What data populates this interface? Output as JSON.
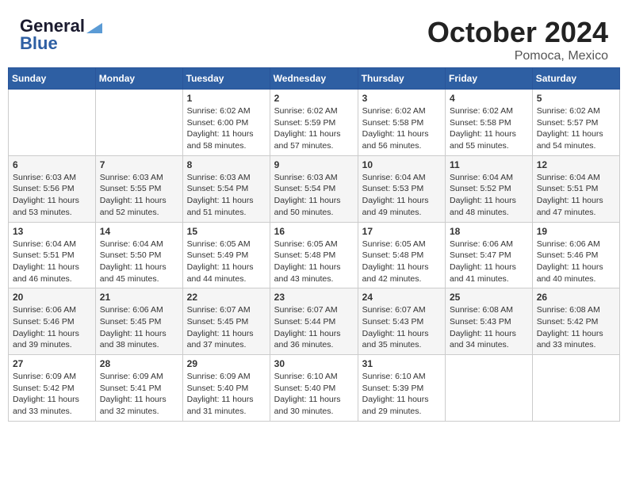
{
  "header": {
    "logo_line1": "General",
    "logo_line2": "Blue",
    "title": "October 2024",
    "subtitle": "Pomoca, Mexico"
  },
  "weekdays": [
    "Sunday",
    "Monday",
    "Tuesday",
    "Wednesday",
    "Thursday",
    "Friday",
    "Saturday"
  ],
  "weeks": [
    [
      {
        "day": null
      },
      {
        "day": null
      },
      {
        "day": "1",
        "sunrise": "6:02 AM",
        "sunset": "6:00 PM",
        "daylight": "11 hours and 58 minutes."
      },
      {
        "day": "2",
        "sunrise": "6:02 AM",
        "sunset": "5:59 PM",
        "daylight": "11 hours and 57 minutes."
      },
      {
        "day": "3",
        "sunrise": "6:02 AM",
        "sunset": "5:58 PM",
        "daylight": "11 hours and 56 minutes."
      },
      {
        "day": "4",
        "sunrise": "6:02 AM",
        "sunset": "5:58 PM",
        "daylight": "11 hours and 55 minutes."
      },
      {
        "day": "5",
        "sunrise": "6:02 AM",
        "sunset": "5:57 PM",
        "daylight": "11 hours and 54 minutes."
      }
    ],
    [
      {
        "day": "6",
        "sunrise": "6:03 AM",
        "sunset": "5:56 PM",
        "daylight": "11 hours and 53 minutes."
      },
      {
        "day": "7",
        "sunrise": "6:03 AM",
        "sunset": "5:55 PM",
        "daylight": "11 hours and 52 minutes."
      },
      {
        "day": "8",
        "sunrise": "6:03 AM",
        "sunset": "5:54 PM",
        "daylight": "11 hours and 51 minutes."
      },
      {
        "day": "9",
        "sunrise": "6:03 AM",
        "sunset": "5:54 PM",
        "daylight": "11 hours and 50 minutes."
      },
      {
        "day": "10",
        "sunrise": "6:04 AM",
        "sunset": "5:53 PM",
        "daylight": "11 hours and 49 minutes."
      },
      {
        "day": "11",
        "sunrise": "6:04 AM",
        "sunset": "5:52 PM",
        "daylight": "11 hours and 48 minutes."
      },
      {
        "day": "12",
        "sunrise": "6:04 AM",
        "sunset": "5:51 PM",
        "daylight": "11 hours and 47 minutes."
      }
    ],
    [
      {
        "day": "13",
        "sunrise": "6:04 AM",
        "sunset": "5:51 PM",
        "daylight": "11 hours and 46 minutes."
      },
      {
        "day": "14",
        "sunrise": "6:04 AM",
        "sunset": "5:50 PM",
        "daylight": "11 hours and 45 minutes."
      },
      {
        "day": "15",
        "sunrise": "6:05 AM",
        "sunset": "5:49 PM",
        "daylight": "11 hours and 44 minutes."
      },
      {
        "day": "16",
        "sunrise": "6:05 AM",
        "sunset": "5:48 PM",
        "daylight": "11 hours and 43 minutes."
      },
      {
        "day": "17",
        "sunrise": "6:05 AM",
        "sunset": "5:48 PM",
        "daylight": "11 hours and 42 minutes."
      },
      {
        "day": "18",
        "sunrise": "6:06 AM",
        "sunset": "5:47 PM",
        "daylight": "11 hours and 41 minutes."
      },
      {
        "day": "19",
        "sunrise": "6:06 AM",
        "sunset": "5:46 PM",
        "daylight": "11 hours and 40 minutes."
      }
    ],
    [
      {
        "day": "20",
        "sunrise": "6:06 AM",
        "sunset": "5:46 PM",
        "daylight": "11 hours and 39 minutes."
      },
      {
        "day": "21",
        "sunrise": "6:06 AM",
        "sunset": "5:45 PM",
        "daylight": "11 hours and 38 minutes."
      },
      {
        "day": "22",
        "sunrise": "6:07 AM",
        "sunset": "5:45 PM",
        "daylight": "11 hours and 37 minutes."
      },
      {
        "day": "23",
        "sunrise": "6:07 AM",
        "sunset": "5:44 PM",
        "daylight": "11 hours and 36 minutes."
      },
      {
        "day": "24",
        "sunrise": "6:07 AM",
        "sunset": "5:43 PM",
        "daylight": "11 hours and 35 minutes."
      },
      {
        "day": "25",
        "sunrise": "6:08 AM",
        "sunset": "5:43 PM",
        "daylight": "11 hours and 34 minutes."
      },
      {
        "day": "26",
        "sunrise": "6:08 AM",
        "sunset": "5:42 PM",
        "daylight": "11 hours and 33 minutes."
      }
    ],
    [
      {
        "day": "27",
        "sunrise": "6:09 AM",
        "sunset": "5:42 PM",
        "daylight": "11 hours and 33 minutes."
      },
      {
        "day": "28",
        "sunrise": "6:09 AM",
        "sunset": "5:41 PM",
        "daylight": "11 hours and 32 minutes."
      },
      {
        "day": "29",
        "sunrise": "6:09 AM",
        "sunset": "5:40 PM",
        "daylight": "11 hours and 31 minutes."
      },
      {
        "day": "30",
        "sunrise": "6:10 AM",
        "sunset": "5:40 PM",
        "daylight": "11 hours and 30 minutes."
      },
      {
        "day": "31",
        "sunrise": "6:10 AM",
        "sunset": "5:39 PM",
        "daylight": "11 hours and 29 minutes."
      },
      {
        "day": null
      },
      {
        "day": null
      }
    ]
  ],
  "labels": {
    "sunrise": "Sunrise:",
    "sunset": "Sunset:",
    "daylight": "Daylight:"
  }
}
